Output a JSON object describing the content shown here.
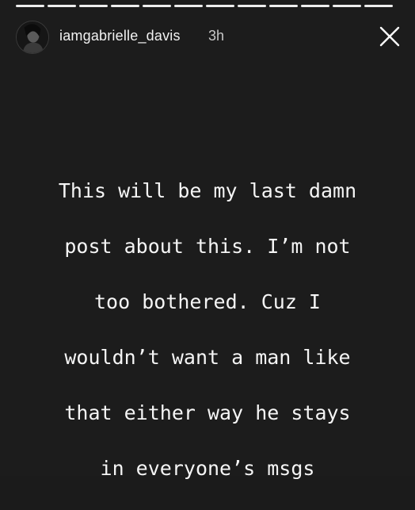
{
  "story": {
    "progress": {
      "segments_total": 12,
      "segments_viewed": 12
    },
    "header": {
      "avatar_icon": "profile-photo-avatar",
      "username": "iamgabrielle_davis",
      "time": "3h",
      "close_icon": "close-icon"
    },
    "text_lines": [
      "This will be my last damn",
      "post about this. I’m not",
      "too bothered. Cuz I",
      "wouldn’t want a man like",
      "that either way he stays",
      "in everyone’s msgs"
    ]
  },
  "colors": {
    "background": "#1c1c1c",
    "text": "#f5f5f5"
  }
}
